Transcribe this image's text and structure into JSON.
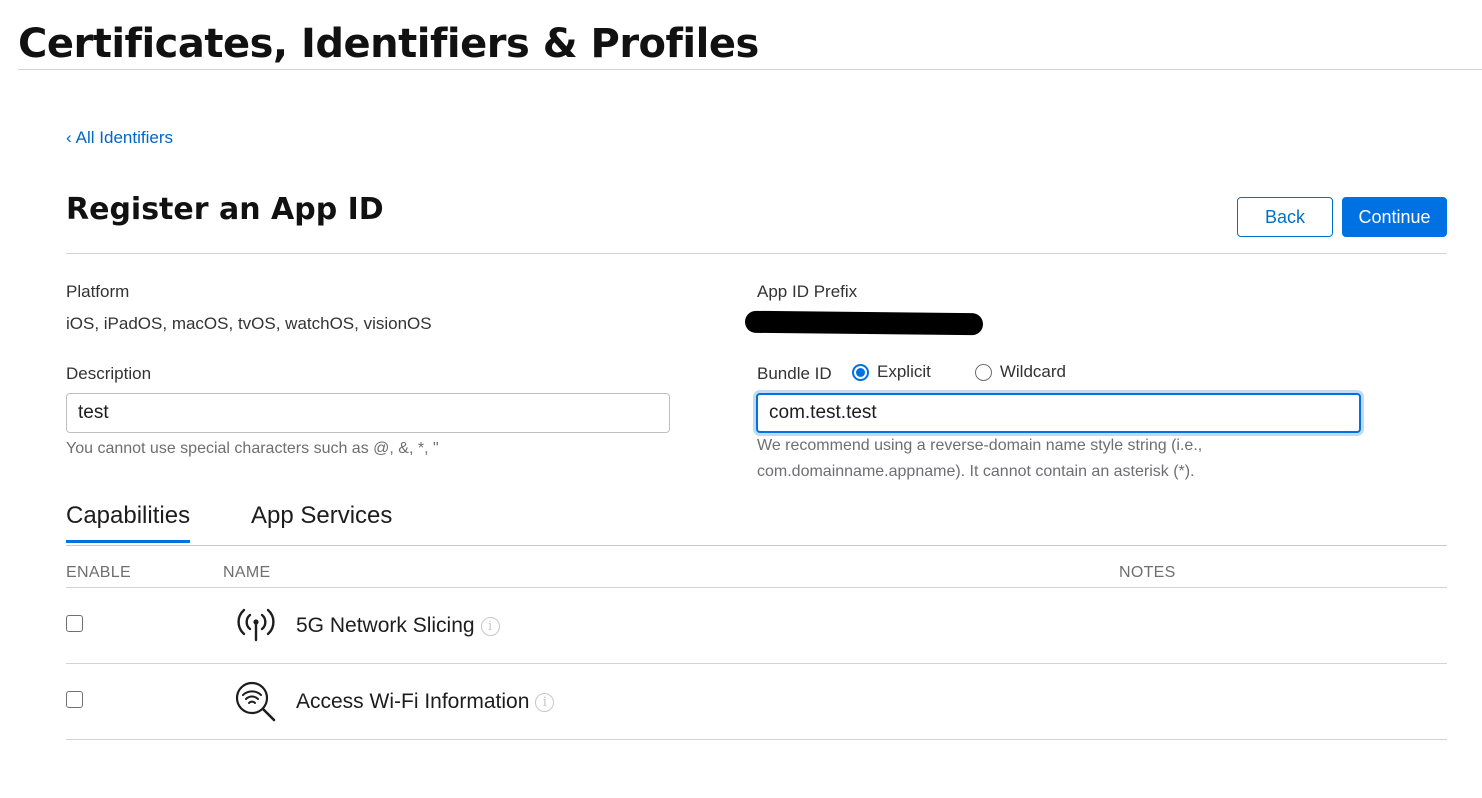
{
  "page": {
    "title": "Certificates, Identifiers & Profiles"
  },
  "nav": {
    "back_link_label": "All Identifiers",
    "chevron": "‹"
  },
  "form_header": {
    "title": "Register an App ID",
    "back_button": "Back",
    "continue_button": "Continue"
  },
  "platform": {
    "label": "Platform",
    "value": "iOS, iPadOS, macOS, tvOS, watchOS, visionOS"
  },
  "app_id_prefix": {
    "label": "App ID Prefix",
    "value_redacted": true
  },
  "description": {
    "label": "Description",
    "value": "test",
    "hint": "You cannot use special characters such as @, &, *, \""
  },
  "bundle_id": {
    "label": "Bundle ID",
    "options": [
      {
        "label": "Explicit",
        "selected": true
      },
      {
        "label": "Wildcard",
        "selected": false
      }
    ],
    "value": "com.test.test",
    "hint_line1": "We recommend using a reverse-domain name style string (i.e.,",
    "hint_line2": "com.domainname.appname). It cannot contain an asterisk (*)."
  },
  "tabs": [
    {
      "label": "Capabilities",
      "active": true
    },
    {
      "label": "App Services",
      "active": false
    }
  ],
  "table": {
    "headers": {
      "enable": "ENABLE",
      "name": "NAME",
      "notes": "NOTES"
    },
    "rows": [
      {
        "name": "5G Network Slicing",
        "icon": "antenna-signal-icon",
        "enabled": false
      },
      {
        "name": "Access Wi-Fi Information",
        "icon": "wifi-search-icon",
        "enabled": false
      }
    ]
  },
  "colors": {
    "accent": "#0071e3",
    "link": "#0066cc",
    "divider": "#d2d2d7",
    "muted_text": "#6e6e73"
  }
}
